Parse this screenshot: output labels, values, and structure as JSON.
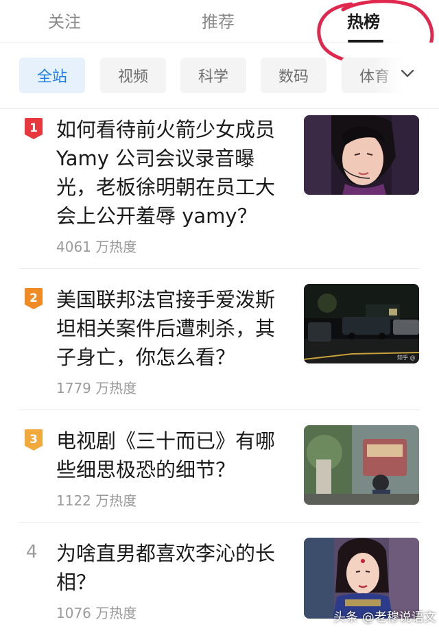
{
  "tabs": [
    "关注",
    "推荐",
    "热榜"
  ],
  "categories": [
    "全站",
    "视频",
    "科学",
    "数码",
    "体育"
  ],
  "items": [
    {
      "rank": "1",
      "title": "如何看待前火箭少女成员 Yamy 公司会议录音曝光，老板徐明朝在员工大会上公开羞辱 yamy？",
      "heat": "4061 万热度",
      "badge_color": "#e8383d"
    },
    {
      "rank": "2",
      "title": "美国联邦法官接手爱泼斯坦相关案件后遭刺杀，其子身亡，你怎么看？",
      "heat": "1779 万热度",
      "badge_color": "#f08a24"
    },
    {
      "rank": "3",
      "title": "电视剧《三十而已》有哪些细思极恐的细节？",
      "heat": "1122 万热度",
      "badge_color": "#f2a93b"
    },
    {
      "rank": "4",
      "title": "为啥直男都喜欢李沁的长相？",
      "heat": "1076 万热度"
    }
  ],
  "thumb2_watermark": "知乎 @",
  "watermark": "头条 @老穆说语文",
  "colors": {
    "accent": "#1b7ee8",
    "annotation": "#e0284f"
  }
}
